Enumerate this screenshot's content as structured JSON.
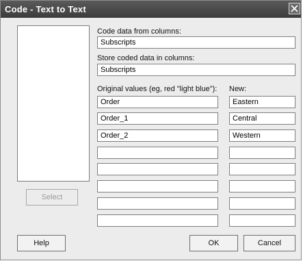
{
  "dialog": {
    "title": "Code - Text to Text"
  },
  "labels": {
    "code_from": "Code data from columns:",
    "store_in": "Store coded data in columns:",
    "original": "Original values (eg,  red  \"light blue\"):",
    "new": "New:"
  },
  "fields": {
    "code_from_value": "Subscripts",
    "store_in_value": "Subscripts"
  },
  "original_values": [
    "Order",
    "Order_1",
    "Order_2",
    "",
    "",
    "",
    "",
    ""
  ],
  "new_values": [
    "Eastern",
    "Central",
    "Western",
    "",
    "",
    "",
    "",
    ""
  ],
  "buttons": {
    "select": "Select",
    "help": "Help",
    "ok": "OK",
    "cancel": "Cancel"
  },
  "icons": {
    "close": "close-icon"
  }
}
